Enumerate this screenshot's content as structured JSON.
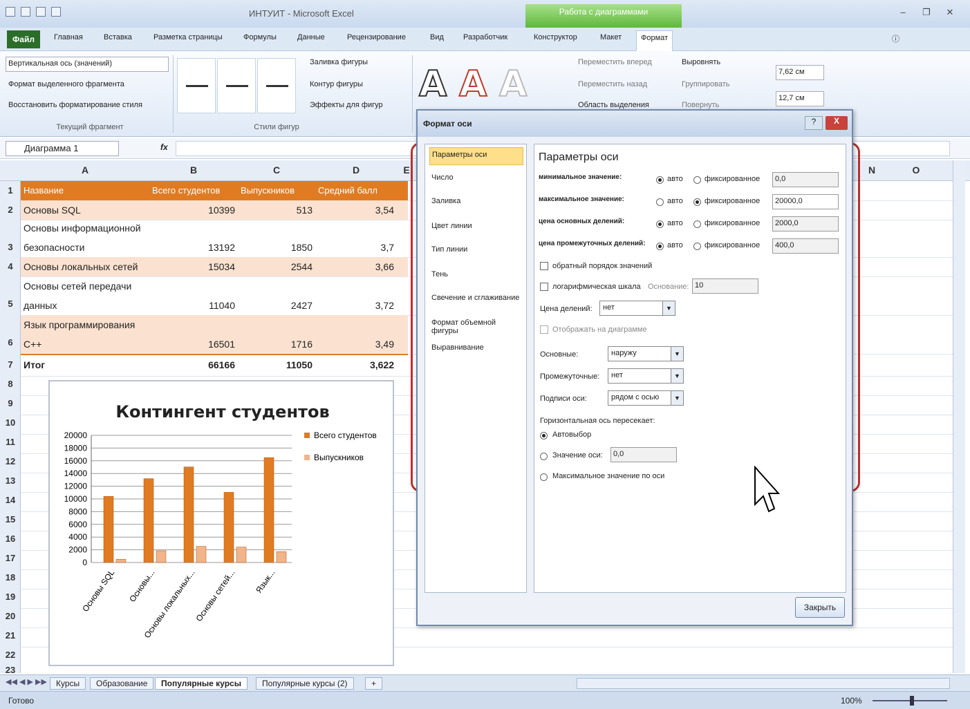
{
  "app": {
    "title": "ИНТУИТ - Microsoft Excel",
    "context_group": "Работа с диаграммами"
  },
  "tabs": [
    "Файл",
    "Главная",
    "Вставка",
    "Разметка страницы",
    "Формулы",
    "Данные",
    "Рецензирование",
    "Вид",
    "Разработчик",
    "Конструктор",
    "Макет",
    "Формат"
  ],
  "active_tab": "Формат",
  "ribbon": {
    "element_select": "Вертикальная ось (значений)",
    "format_selection": "Формат выделенного фрагмента",
    "reset_style": "Восстановить форматирование стиля",
    "group_current": "Текущий фрагмент",
    "fill_shape": "Заливка фигуры",
    "outline_shape": "Контур фигуры",
    "effects_shape": "Эффекты для фигур",
    "group_styles": "Стили фигур",
    "bring_forward": "Переместить вперед",
    "send_backward": "Переместить назад",
    "selection_pane": "Область выделения",
    "align": "Выровнять",
    "group": "Группировать",
    "rotate": "Повернуть",
    "height": "7,62 см",
    "width": "12,7 см",
    "wordart_letter": "A"
  },
  "formula_bar": {
    "name_box": "Диаграмма 1",
    "fx": "fx"
  },
  "columns": [
    "A",
    "B",
    "C",
    "D",
    "E",
    "N",
    "O"
  ],
  "rows": [
    "1",
    "2",
    "3",
    "4",
    "5",
    "6",
    "7",
    "8",
    "9",
    "10",
    "11",
    "12",
    "13",
    "14",
    "15",
    "16",
    "17",
    "18",
    "19",
    "20",
    "21",
    "22",
    "23"
  ],
  "table": {
    "headers": [
      "Название",
      "Всего студентов",
      "Выпускников",
      "Средний балл"
    ],
    "data": [
      {
        "name_lines": [
          "Основы SQL"
        ],
        "total": "10399",
        "grads": "513",
        "avg": "3,54"
      },
      {
        "name_lines": [
          "Основы информационной",
          "безопасности"
        ],
        "total": "13192",
        "grads": "1850",
        "avg": "3,7"
      },
      {
        "name_lines": [
          "Основы локальных сетей"
        ],
        "total": "15034",
        "grads": "2544",
        "avg": "3,66"
      },
      {
        "name_lines": [
          "Основы сетей передачи",
          "данных"
        ],
        "total": "11040",
        "grads": "2427",
        "avg": "3,72"
      },
      {
        "name_lines": [
          "Язык программирования",
          "C++"
        ],
        "total": "16501",
        "grads": "1716",
        "avg": "3,49"
      }
    ],
    "total_row": {
      "name": "Итог",
      "total": "66166",
      "grads": "11050",
      "avg": "3,622"
    }
  },
  "chart_data": {
    "type": "bar",
    "title": "Контингент студентов",
    "categories": [
      "Основы SQL",
      "Основы...",
      "Основы локальных...",
      "Основы сетей...",
      "Язык..."
    ],
    "series": [
      {
        "name": "Всего студентов",
        "values": [
          10399,
          13192,
          15034,
          11040,
          16501
        ],
        "color": "#e07b22"
      },
      {
        "name": "Выпускников",
        "values": [
          513,
          1850,
          2544,
          2427,
          1716
        ],
        "color": "#f2b48a"
      }
    ],
    "ylim": [
      0,
      20000
    ],
    "yticks": [
      "20000",
      "18000",
      "16000",
      "14000",
      "12000",
      "10000",
      "8000",
      "6000",
      "4000",
      "2000",
      "0"
    ],
    "legend": "right",
    "grid": true
  },
  "dialog": {
    "title": "Формат оси",
    "nav": [
      "Параметры оси",
      "Число",
      "Заливка",
      "Цвет линии",
      "Тип линии",
      "Тень",
      "Свечение и сглаживание",
      "Формат объемной фигуры",
      "Выравнивание"
    ],
    "selected_nav": "Параметры оси",
    "heading": "Параметры оси",
    "rows": [
      {
        "label": "минимальное значение:",
        "auto": "авто",
        "fixed": "фиксированное",
        "value": "0,0",
        "selected": "auto"
      },
      {
        "label": "максимальное значение:",
        "auto": "авто",
        "fixed": "фиксированное",
        "value": "20000,0",
        "selected": "fixed"
      },
      {
        "label": "цена основных делений:",
        "auto": "авто",
        "fixed": "фиксированное",
        "value": "2000,0",
        "selected": "auto"
      },
      {
        "label": "цена промежуточных делений:",
        "auto": "авто",
        "fixed": "фиксированное",
        "value": "400,0",
        "selected": "auto"
      }
    ],
    "reverse_order": "обратный порядок значений",
    "log_scale": "логарифмическая шкала",
    "log_base_label": "Основание:",
    "log_base_value": "10",
    "display_units_label": "Цена делений:",
    "display_units_value": "нет",
    "show_on_chart": "Отображать на диаграмме",
    "major_tick_label": "Основные:",
    "major_tick_value": "наружу",
    "minor_tick_label": "Промежуточные:",
    "minor_tick_value": "нет",
    "axis_labels_label": "Подписи оси:",
    "axis_labels_value": "рядом с осью",
    "crosses_heading": "Горизонтальная ось пересекает:",
    "crosses_auto": "Автовыбор",
    "crosses_value_label": "Значение оси:",
    "crosses_value": "0,0",
    "crosses_max": "Максимальное значение по оси",
    "close": "Закрыть",
    "help": "?",
    "close_x": "X"
  },
  "sheets": [
    "Курсы",
    "Образование",
    "Популярные курсы",
    "Популярные курсы (2)"
  ],
  "active_sheet": "Популярные курсы",
  "status": {
    "ready": "Готово",
    "zoom": "100%"
  }
}
